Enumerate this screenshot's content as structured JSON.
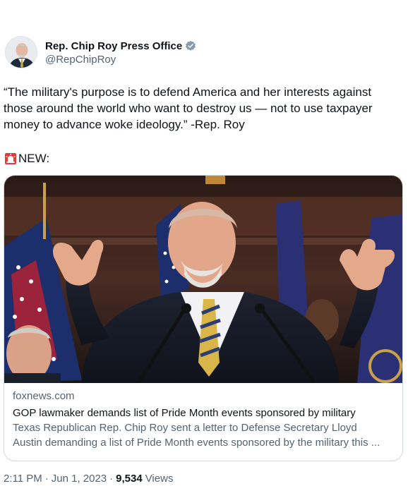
{
  "author": {
    "display_name": "Rep. Chip Roy Press Office",
    "handle": "@RepChipRoy",
    "verified_icon": "verified-badge-icon",
    "verified_color": "#829aab"
  },
  "tweet": {
    "text": "“The military's purpose is to defend America and her interests against those around the world who want to destroy us — not to use taxpayer money to advance woke ideology.” -Rep. Roy",
    "new_label": "NEW:",
    "siren_icon": "rotating-light-icon"
  },
  "card": {
    "image_alt_icon": "photo-podium-icon",
    "domain": "foxnews.com",
    "title": "GOP lawmaker demands list of Pride Month events sponsored by military",
    "description_line1": "Texas Republican Rep. Chip Roy sent a letter to Defense Secretary Lloyd",
    "description_line2": "Austin demanding a list of Pride Month events sponsored by the military this ..."
  },
  "meta": {
    "time": "2:11 PM",
    "date": "Jun 1, 2023",
    "separator": "·",
    "views_count": "9,534",
    "views_label": "Views"
  },
  "colors": {
    "text_primary": "#0f1419",
    "text_secondary": "#536471",
    "border": "#cfd9de"
  }
}
